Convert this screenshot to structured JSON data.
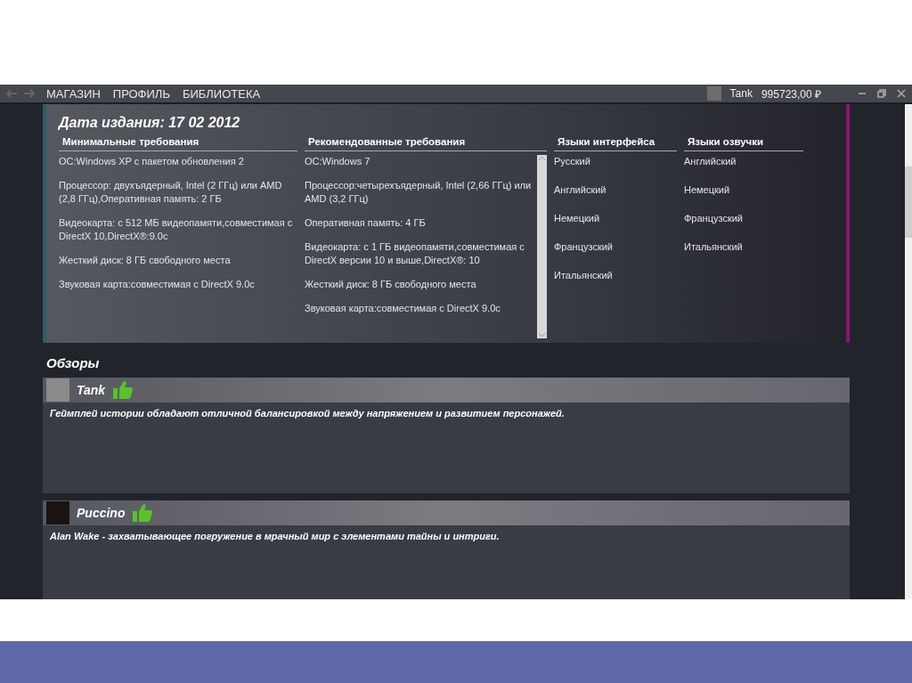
{
  "nav": {
    "items": [
      "МАГАЗИН",
      "ПРОФИЛЬ",
      "БИБЛИОТЕКА"
    ]
  },
  "account": {
    "name": "Tank",
    "balance": "995723,00 ₽"
  },
  "details": {
    "release_date": "Дата издания: 17 02 2012",
    "minimum": {
      "title": "Минимальные требования",
      "lines": [
        "ОС:Windows XP с пакетом обновления 2",
        "Процессор: двухъядерный, Intel (2 ГГц) или AMD (2,8 ГГц),Оперативная память: 2 ГБ",
        "Видеокарта: с 512 МБ видеопамяти,совместимая с DirectX 10,DirectX®:9.0c",
        "Жесткий диск: 8 ГБ свободного места",
        "Звуковая карта:совместимая с DirectX 9.0c"
      ]
    },
    "recommended": {
      "title": "Рекомендованные требования",
      "lines": [
        "ОС:Windows 7",
        "Процессор:четырехъядерный, Intel (2,66 ГГц) или AMD (3,2 ГГц)",
        "Оперативная память: 4 ГБ",
        "Видеокарта: с 1 ГБ видеопамяти,совместимая с DirectX версии 10 и выше,DirectX®: 10",
        "Жесткий диск: 8 ГБ свободного места",
        "Звуковая карта:совместимая с DirectX 9.0c"
      ]
    },
    "interface_languages": {
      "title": "Языки интерфейса",
      "items": [
        "Русский",
        "Английский",
        "Немецкий",
        "Французский",
        "Итальянский"
      ]
    },
    "voice_languages": {
      "title": "Языки озвучки",
      "items": [
        "Английский",
        "Немецкий",
        "Французский",
        "Итальянский"
      ]
    }
  },
  "reviews": {
    "title": "Обзоры",
    "items": [
      {
        "author": "Tank",
        "text": "Геймплей истории обладают отличной балансировкой между напряжением и развитием персонажей."
      },
      {
        "author": "Puccino",
        "text": "Alan Wake - захватывающее погружение в мрачный мир с элементами тайны и интриги."
      }
    ]
  }
}
